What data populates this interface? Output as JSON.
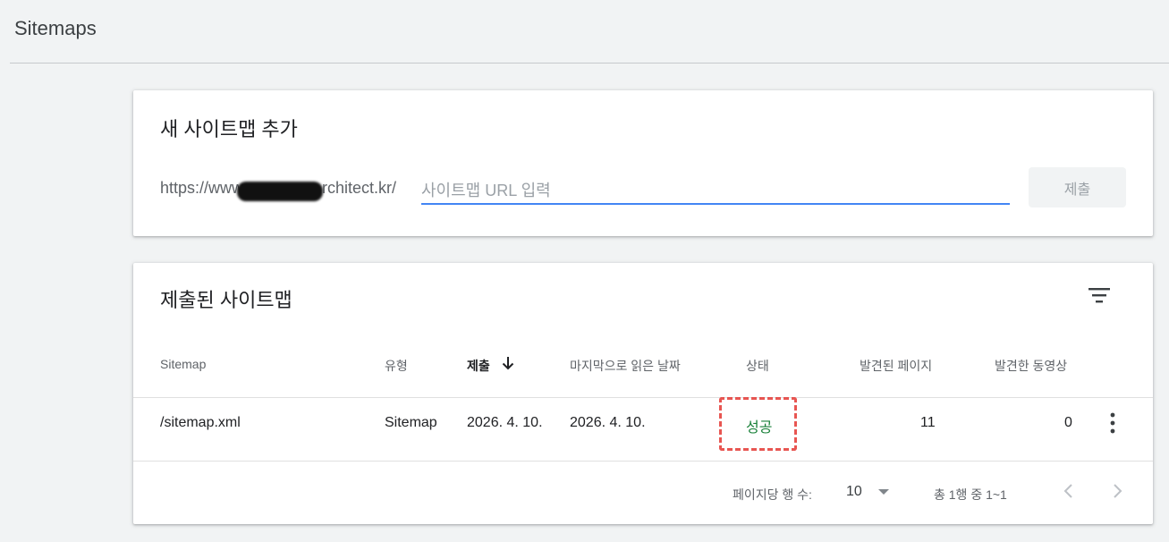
{
  "page": {
    "title": "Sitemaps"
  },
  "add_sitemap": {
    "title": "새 사이트맵 추가",
    "url_prefix": "https://www.",
    "url_suffix": "rchitect.kr/",
    "input_value": "",
    "input_placeholder": "사이트맵 URL 입력",
    "submit_label": "제출",
    "submit_enabled": false
  },
  "submitted_sitemaps": {
    "title": "제출된 사이트맵",
    "filter_icon": "filter-icon",
    "columns": {
      "sitemap": "Sitemap",
      "type": "유형",
      "submitted": "제출",
      "last_read": "마지막으로 읽은 날짜",
      "status": "상태",
      "discovered_pages": "발견된 페이지",
      "discovered_videos": "발견한 동영상"
    },
    "sort": {
      "column": "submitted",
      "direction": "descending",
      "icon": "arrow-down-icon"
    },
    "rows": [
      {
        "sitemap": "/sitemap.xml",
        "type": "Sitemap",
        "submitted": "2026. 4. 10.",
        "last_read": "2026. 4. 10.",
        "status": "성공",
        "discovered_pages": "11",
        "discovered_videos": "0"
      }
    ],
    "pagination": {
      "rows_per_page_label": "페이지당 행 수:",
      "rows_per_page": "10",
      "range_text": "총 1행 중 1~1",
      "prev_icon": "chevron-left-icon",
      "next_icon": "chevron-right-icon"
    }
  },
  "colors": {
    "background": "#f1f3f4",
    "input_underline": "#4285f4",
    "status_success": "#188038",
    "annotation_mark": "#e53935"
  }
}
